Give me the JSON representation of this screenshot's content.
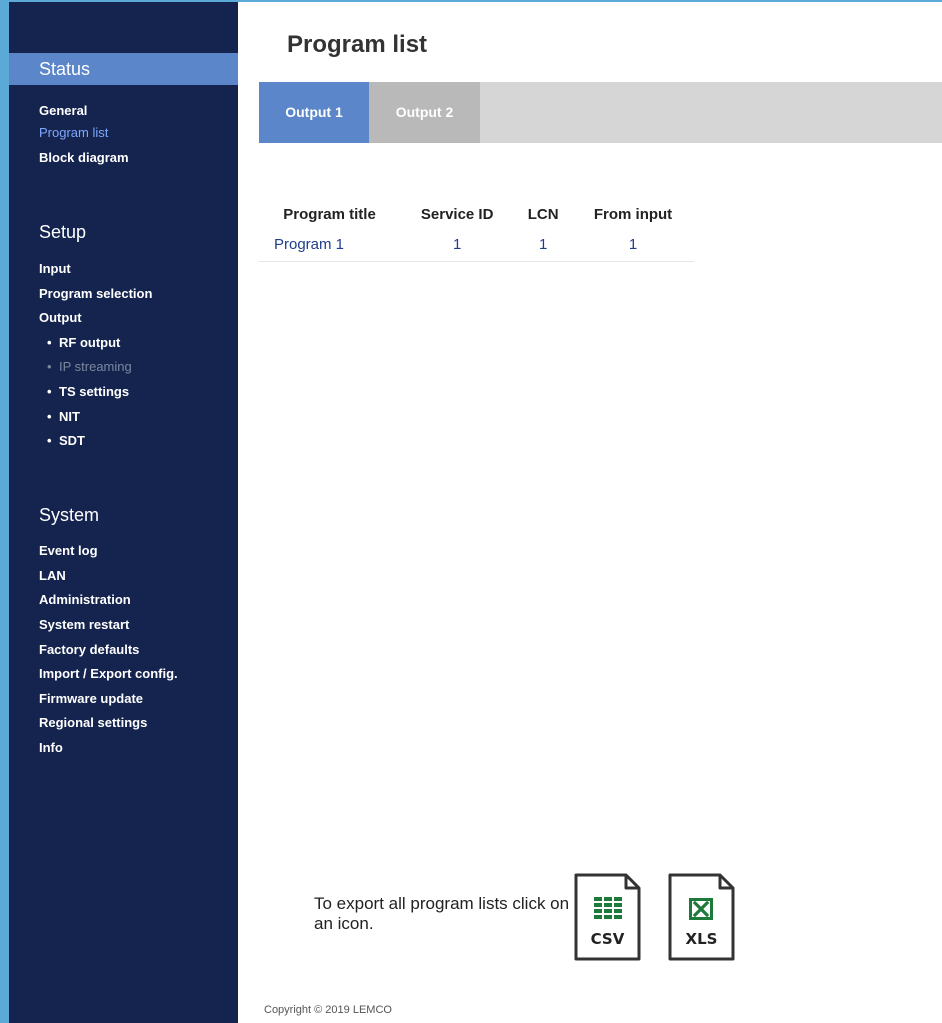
{
  "sidebar": {
    "status_header": "Status",
    "status_items": [
      "General",
      "Program list",
      "Block diagram"
    ],
    "setup_header": "Setup",
    "setup_items": [
      "Input",
      "Program selection",
      "Output"
    ],
    "output_subitems": [
      "RF output",
      "IP streaming",
      "TS settings",
      "NIT",
      "SDT"
    ],
    "system_header": "System",
    "system_items": [
      "Event log",
      "LAN",
      "Administration",
      "System restart",
      "Factory defaults",
      "Import / Export config.",
      "Firmware update",
      "Regional settings",
      "Info"
    ]
  },
  "main": {
    "title": "Program list",
    "tabs": [
      "Output 1",
      "Output 2"
    ],
    "table": {
      "headers": [
        "Program title",
        "Service ID",
        "LCN",
        "From input"
      ],
      "rows": [
        [
          "Program 1",
          "1",
          "1",
          "1"
        ]
      ]
    },
    "export_text": "To export all program lists click on an icon.",
    "export_icons": [
      "CSV",
      "XLS"
    ],
    "copyright": "Copyright © 2019 LEMCO"
  },
  "colors": {
    "sidebar_bg": "#14244e",
    "accent": "#5b86c9",
    "active_link": "#7fa8ff",
    "excel_green": "#1d7a3a"
  }
}
